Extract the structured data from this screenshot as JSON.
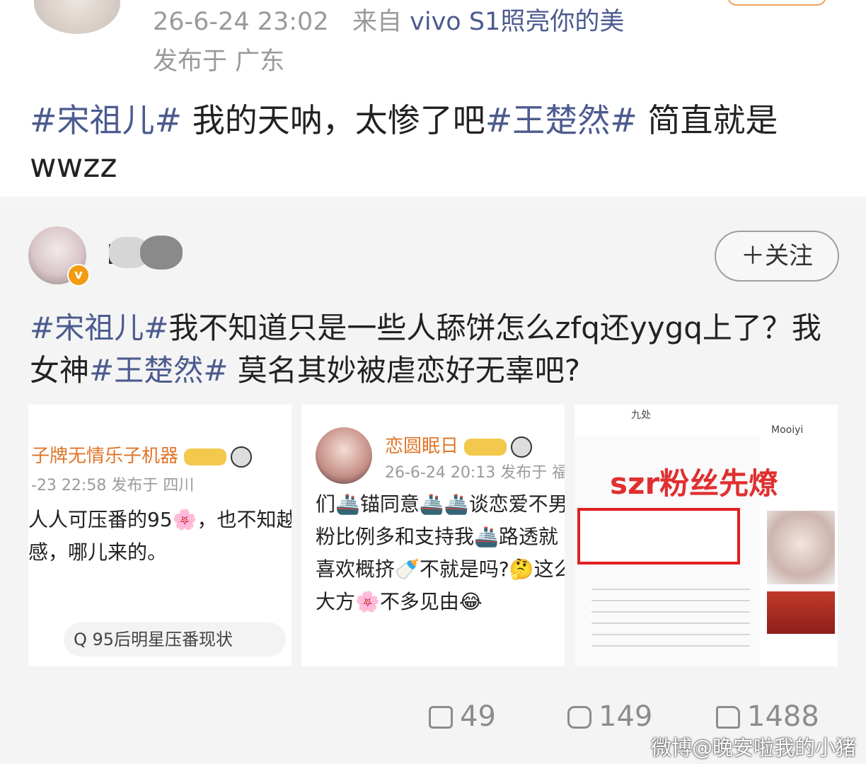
{
  "post": {
    "time": "26-6-24 23:02",
    "source_prefix": "来自",
    "source": "vivo S1照亮你的美",
    "location": "发布于 广东",
    "text": {
      "tag1": "#宋祖儿#",
      "part1": " 我的天呐，太惨了吧",
      "tag2": "#王楚然#",
      "part2": " 简直就是wwzz"
    }
  },
  "repost": {
    "follow_label": "＋关注",
    "text": {
      "tag1": "#宋祖儿#",
      "part1": "我不知道只是一些人舔饼怎么zfq还yygq上了？我女神",
      "tag2": "#王楚然#",
      "part2": " 莫名其妙被虐恋好无辜吧?"
    },
    "images": {
      "img1": {
        "name": "子牌无情乐子机器",
        "meta": "-23 22:58  发布于 四川",
        "text": "人人可压番的95🌸，也不知越感，哪儿来的。",
        "search": "Q 95后明星压番现状"
      },
      "img2": {
        "name": "恋圆眠日",
        "meta": "26-6-24 20:13  发布于 福",
        "text": "们🚢锚同意🚢🚢谈恋爱不男粉比例多和支持我🚢路透就喜欢概挤🍼不就是吗?🤔这么大方🌸不多见由😂"
      },
      "img3": {
        "headline": "szr粉丝先燎",
        "top_user": "九处",
        "right_user": "Mooiyi"
      }
    }
  },
  "stats": {
    "shares": "49",
    "comments": "149",
    "likes": "1488"
  },
  "watermark": "微博@晚安啦我的小猪"
}
